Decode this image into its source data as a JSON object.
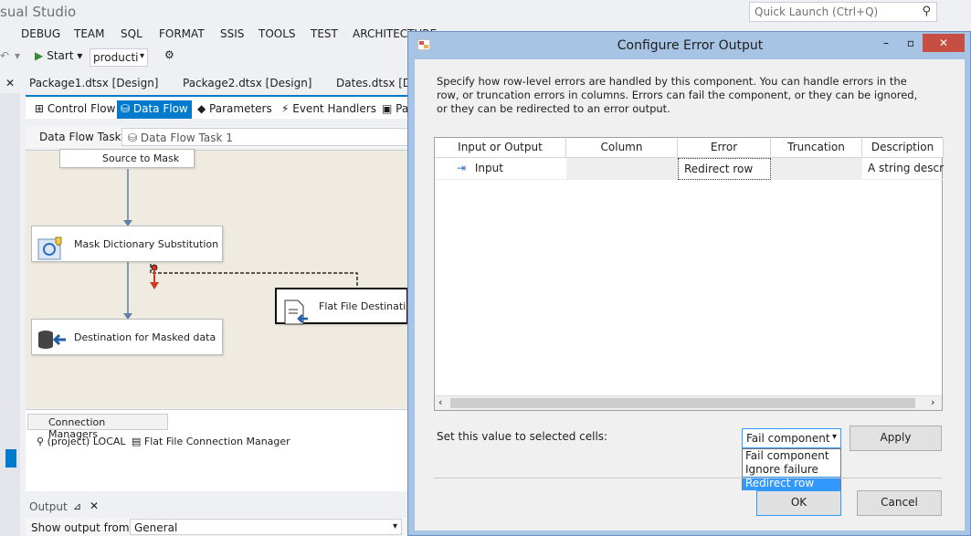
{
  "app": {
    "title": "sual Studio"
  },
  "quick_launch": {
    "placeholder": "Quick Launch (Ctrl+Q)"
  },
  "menu": [
    "DEBUG",
    "TEAM",
    "SQL",
    "FORMAT",
    "SSIS",
    "TOOLS",
    "TEST",
    "ARCHITECTURE"
  ],
  "toolbar": {
    "start_label": "Start",
    "config_value": "producti"
  },
  "doc_tabs": [
    "Package1.dtsx [Design]",
    "Package2.dtsx [Design]",
    "Dates.dtsx [Des"
  ],
  "designer_tabs": [
    "Control Flow",
    "Data Flow",
    "Parameters",
    "Event Handlers",
    "Pa"
  ],
  "data_flow_task": {
    "label": "Data Flow Task:",
    "value": "Data Flow Task 1"
  },
  "canvas": {
    "components": {
      "source": "Source to Mask",
      "mask": "Mask Dictionary Substitution",
      "flat_dest": "Flat File Destination",
      "dest": "Destination for Masked data"
    }
  },
  "connection_managers": {
    "tab": "Connection Managers",
    "items": [
      "(project) LOCAL",
      "Flat File Connection Manager"
    ]
  },
  "output": {
    "title": "Output",
    "show_from_label": "Show output from:",
    "show_from_value": "General"
  },
  "dialog": {
    "title": "Configure Error Output",
    "description": "Specify how row-level errors are handled by this component. You can handle errors in the row, or truncation errors in columns. Errors can fail the component, or they can be ignored, or they can be redirected to an error output.",
    "columns": [
      "Input or Output",
      "Column",
      "Error",
      "Truncation",
      "Description"
    ],
    "rows": [
      {
        "io": "Input",
        "column": "",
        "error": "Redirect row",
        "truncation": "",
        "description": "A string descri..."
      }
    ],
    "set_value_label": "Set this value to selected cells:",
    "selected_value": "Fail component",
    "options": [
      "Fail component",
      "Ignore failure",
      "Redirect row"
    ],
    "highlighted_option": "Redirect row",
    "apply_label": "Apply",
    "ok_label": "OK",
    "cancel_label": "Cancel"
  }
}
